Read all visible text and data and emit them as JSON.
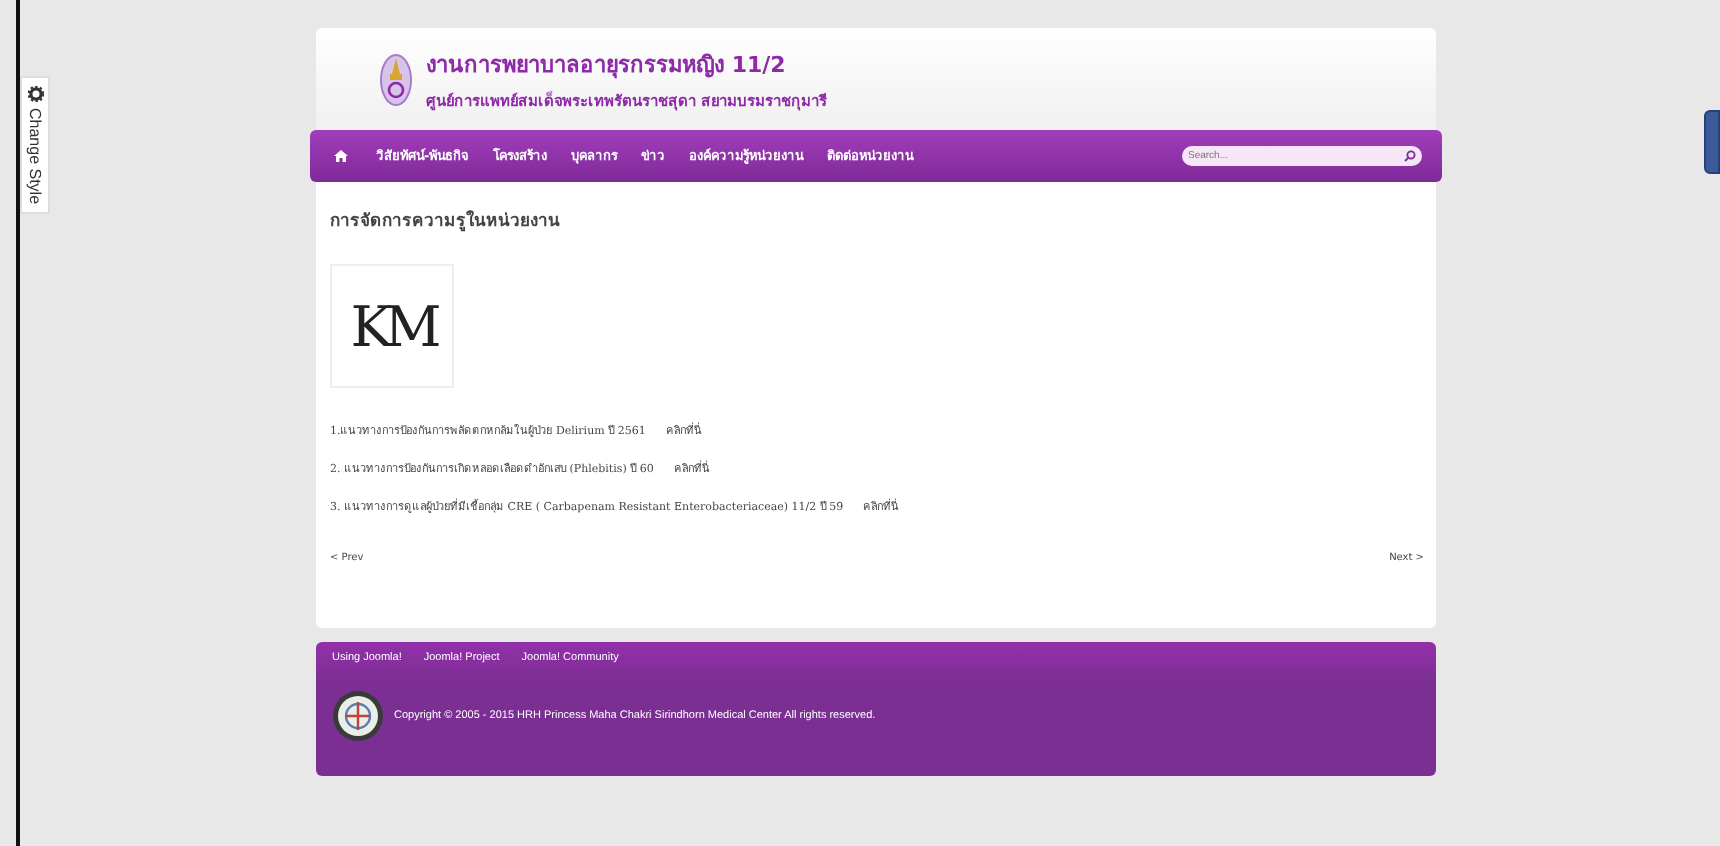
{
  "side_tab": {
    "label": "Change Style"
  },
  "header": {
    "title": "งานการพยาบาลอายุรกรรมหญิง 11/2",
    "subtitle": "ศูนย์การแพทย์สมเด็จพระเทพรัตนราชสุดา สยามบรมราชกุมารี"
  },
  "nav": {
    "items": [
      {
        "kind": "home"
      },
      {
        "kind": "text",
        "label": "วิสัยทัศน์-พันธกิจ"
      },
      {
        "kind": "text",
        "label": "โครงสร้าง"
      },
      {
        "kind": "text",
        "label": "บุคลากร"
      },
      {
        "kind": "text",
        "label": "ข่าว"
      },
      {
        "kind": "text",
        "label": "องค์ความรู้หน่วยงาน"
      },
      {
        "kind": "text",
        "label": "ติดต่อหน่วยงาน"
      }
    ],
    "search": {
      "placeholder": "Search..."
    }
  },
  "article": {
    "title": "การจัดการความรูในหน่วยงาน",
    "image_text": "KM",
    "items": [
      {
        "text": "1.แนวทางการป้องกันการพลัดตกหกล้มในผู้ป่วย Delirium  ปี  2561",
        "link": "คลิกที่นี่"
      },
      {
        "text": "2.  แนวทางการป้องกันการเกิดหลอดเลือดดำอักเสบ (Phlebitis) ปี 60",
        "link": "คลิกที่นี่"
      },
      {
        "text": "3.  แนวทางการดูแลผู้ป่วยที่มีเชื้อกลุ่ม CRE ( Carbapenam Resistant Enterobacteriaceae)  11/2  ปี 59",
        "link": "คลิกที่นี่"
      }
    ],
    "prev": "< Prev",
    "next": "Next >"
  },
  "footer": {
    "links": [
      "Using Joomla!",
      "Joomla! Project",
      "Joomla! Community"
    ],
    "copyright": "Copyright © 2005 - 2015 HRH Princess Maha Chakri Sirindhorn Medical Center All rights reserved."
  }
}
